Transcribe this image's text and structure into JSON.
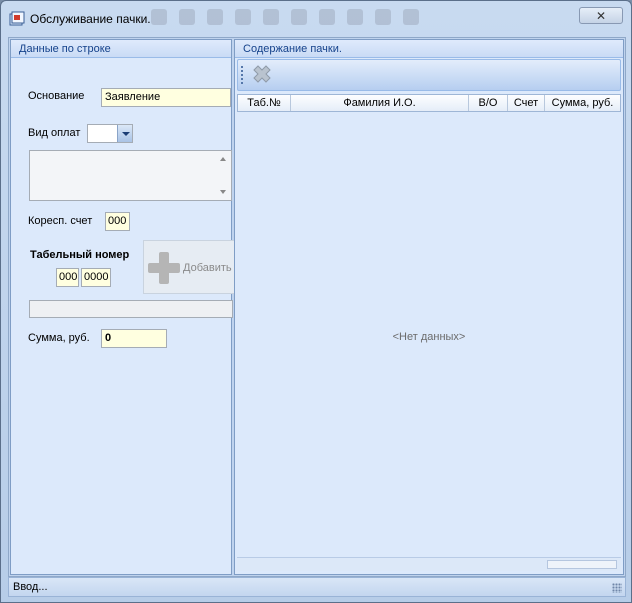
{
  "window": {
    "title": "Обслуживание пачки."
  },
  "left_panel": {
    "header": "Данные по строке",
    "osnovanie_label": "Основание",
    "osnovanie_value": "Заявление",
    "vid_oplat_label": "Вид оплат",
    "koresp_label": "Коресп. счет",
    "koresp_value": "000",
    "tabel_label": "Табельный номер",
    "tabel_part1": "000",
    "tabel_part2": "0000",
    "add_button_label": "Добавить",
    "summa_label": "Сумма, руб.",
    "summa_value": "0"
  },
  "right_panel": {
    "header": "Содержание пачки.",
    "columns": [
      "Таб.№",
      "Фамилия И.О.",
      "В/О",
      "Счет",
      "Сумма, руб."
    ],
    "empty_text": "<Нет данных>"
  },
  "status": {
    "text": "Ввод..."
  }
}
